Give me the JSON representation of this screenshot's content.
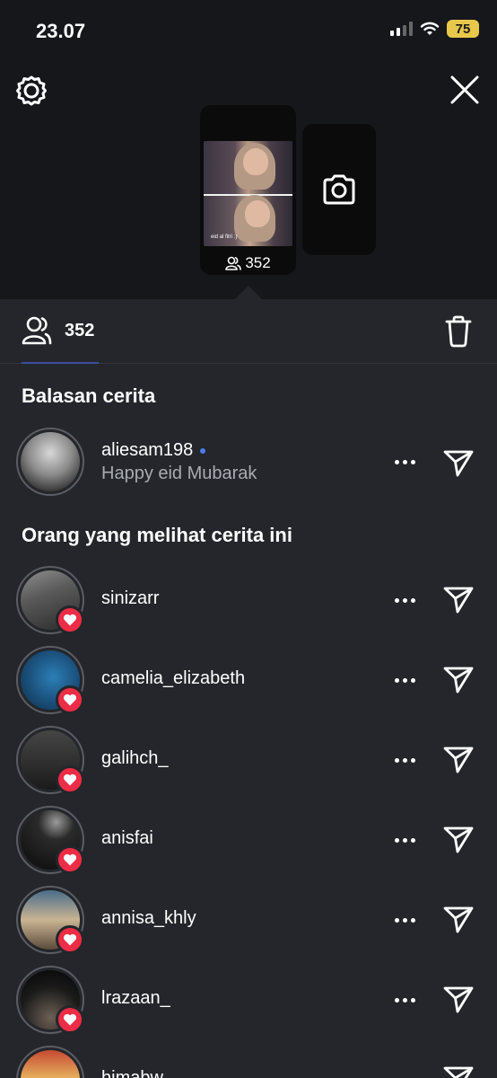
{
  "status_bar": {
    "time": "23.07",
    "battery": "75"
  },
  "story": {
    "caption": "eid al fitri :)",
    "viewer_count": "352"
  },
  "tabs": {
    "viewers_count": "352"
  },
  "sections": {
    "replies_title": "Balasan cerita",
    "viewers_title": "Orang yang melihat cerita ini"
  },
  "reply": {
    "username": "aliesam198",
    "message": "Happy eid Mubarak"
  },
  "viewers": [
    {
      "username": "sinizarr",
      "liked": true
    },
    {
      "username": "camelia_elizabeth",
      "liked": true
    },
    {
      "username": "galihch_",
      "liked": true
    },
    {
      "username": "anisfai",
      "liked": true
    },
    {
      "username": "annisa_khly",
      "liked": true
    },
    {
      "username": "lrazaan_",
      "liked": true
    },
    {
      "username": "himabw",
      "liked": false
    }
  ],
  "colors": {
    "background": "#24262b",
    "top_background": "#15171b",
    "heart": "#ed2c45",
    "accent": "#3d4f9e",
    "online_dot": "#4b7bf5",
    "battery": "#e8c84a"
  },
  "icons": [
    "gear-icon",
    "close-icon",
    "camera-icon",
    "people-icon",
    "trash-icon",
    "more-icon",
    "send-icon",
    "heart-icon"
  ]
}
